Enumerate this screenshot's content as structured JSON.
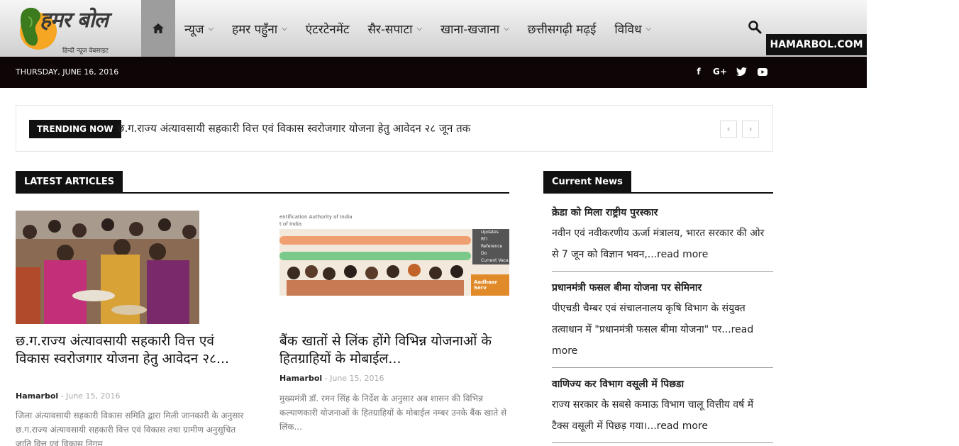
{
  "header": {
    "logo_title": "हमर बोल",
    "logo_subtitle": "हिन्दी न्यूज वेबसाइट",
    "nav": [
      {
        "label": "न्यूज",
        "dropdown": true
      },
      {
        "label": "हमर पहुँना",
        "dropdown": true
      },
      {
        "label": "एंटरटेनमेंट",
        "dropdown": false
      },
      {
        "label": "सैर-सपाटा",
        "dropdown": true
      },
      {
        "label": "खाना-खजाना",
        "dropdown": true
      },
      {
        "label": "छत्तीसगढ़ी मढ़ई",
        "dropdown": false
      },
      {
        "label": "विविध",
        "dropdown": true
      }
    ],
    "domain_badge": "HAMARBOL.COM"
  },
  "topbar": {
    "date": "THURSDAY, JUNE 16, 2016",
    "social_icons": [
      "facebook-icon",
      "google-plus-icon",
      "twitter-icon",
      "youtube-icon"
    ]
  },
  "trending": {
    "label": "TRENDING NOW",
    "headline": "छ.ग.राज्य अंत्यावसायी सहकारी वित्त एवं विकास स्वरोजगार योजना हेतु आवेदन २८ जून तक"
  },
  "latest": {
    "heading": "LATEST ARTICLES",
    "articles": [
      {
        "title": "छ.ग.राज्य अंत्यावसायी सहकारी वित्त एवं विकास स्वरोजगार योजना हेतु आवेदन २८...",
        "author": "Hamarbol",
        "date": "June 15, 2016",
        "excerpt": "जिला अंत्यावसायी सहकारी विकास समिति द्वारा मिली जानकारी के अनुसार छ.ग.राज्य अंत्यावसायी सहकारी वित्त एवं विकास तथा ग्रामीण अनुसूचित जाति वित्त एवं विकास निगम"
      },
      {
        "title": "बैंक खातों से लिंक होंगे विभिन्न योजनाओं के हितग्राहियों के मोबाईल...",
        "author": "Hamarbol",
        "date": "June 15, 2016",
        "excerpt": "मुख्यमंत्री डॉ. रमन सिंह के निर्देश के अनुसार अब शासन की विभिन्न कल्याणकारी योजनाओं के हितग्राहियों के मोबाईल नम्बर उनके बैंक खाते से लिंक...",
        "image_text": {
          "line1": "entification Authority of India",
          "line2": "t of India",
          "menu": [
            "Updates",
            "RTI",
            "Reference Do",
            "Current Vaca"
          ],
          "banner": "Aadhaar Serv"
        }
      }
    ]
  },
  "current": {
    "heading": "Current News",
    "items": [
      {
        "title": "क्रेडा को मिला राष्ट्रीय पुरस्कार",
        "text": "नवीन एवं नवीकरणीय ऊर्जा मंत्रालय, भारत सरकार की ओर से 7 जून को विज्ञान भवन,...read more"
      },
      {
        "title": "प्रधानमंत्री फसल बीमा योजना पर सेमिनार",
        "text": "पीएचडी चैम्बर एवं संचालनालय कृषि विभाग के संयुक्त तत्वाधान में \"प्रधानमंत्री फसल बीमा योजना\" पर...read more"
      },
      {
        "title": "वाणिज्य कर विभाग वसूली में पिछडा",
        "text": "राज्य सरकार के सबसे कमाऊ विभाग चालू वित्तीय वर्ष में टैक्स वसूली में पिछड़ गया।...read more"
      }
    ]
  },
  "colors": {
    "dark": "#0d0506",
    "accent_orange": "#f5a623",
    "logo_green": "#3c7a1e"
  }
}
